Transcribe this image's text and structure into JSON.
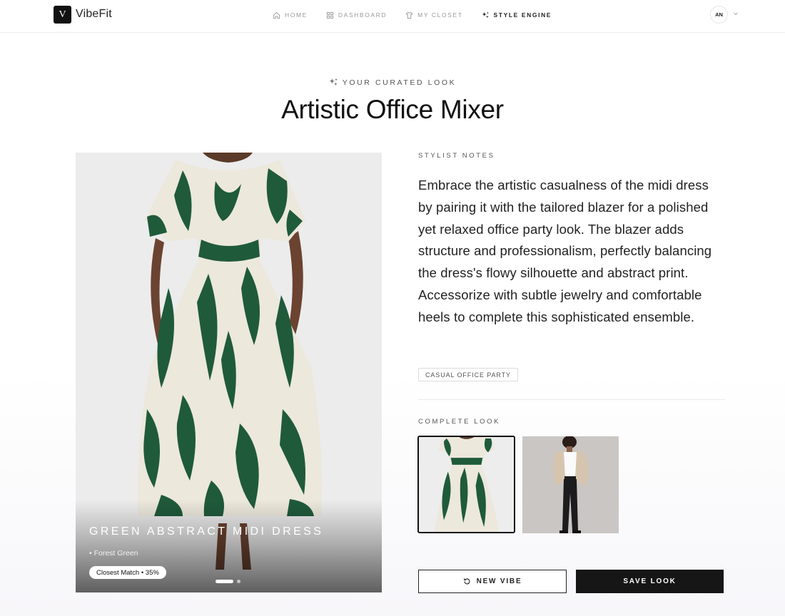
{
  "app": {
    "logo_letter": "V",
    "brand": "VibeFit"
  },
  "nav": {
    "items": [
      {
        "label": "HOME",
        "icon": "home-icon"
      },
      {
        "label": "DASHBOARD",
        "icon": "grid-icon"
      },
      {
        "label": "MY CLOSET",
        "icon": "shirt-icon"
      },
      {
        "label": "STYLE ENGINE",
        "icon": "sparkles-icon",
        "active": true
      }
    ]
  },
  "user": {
    "initials": "AN",
    "menu_icon": "chevron-down-icon"
  },
  "header": {
    "eyebrow": "YOUR CURATED LOOK",
    "eyebrow_icon": "sparkles-icon",
    "title": "Artistic Office Mixer"
  },
  "hero": {
    "item_name": "GREEN ABSTRACT MIDI DRESS",
    "color": "• Forest Green",
    "match_badge": "Closest Match • 35%",
    "carousel": {
      "count": 2,
      "active": 1
    }
  },
  "stylist": {
    "label": "STYLIST NOTES",
    "notes": "Embrace the artistic casualness of the midi dress by pairing it with the tailored blazer for a polished yet relaxed office party look. The blazer adds structure and professionalism, perfectly balancing the dress's flowy silhouette and abstract print. Accessorize with subtle jewelry and comfortable heels to complete this sophisticated ensemble.",
    "tag": "CASUAL OFFICE PARTY"
  },
  "complete_look": {
    "label": "COMPLETE LOOK",
    "items": [
      {
        "name": "green-abstract-midi-dress-thumbnail",
        "selected": true
      },
      {
        "name": "beige-blazer-outfit-thumbnail",
        "selected": false
      }
    ]
  },
  "actions": {
    "new_vibe": "NEW VIBE",
    "new_vibe_icon": "refresh-icon",
    "save_look": "SAVE LOOK"
  },
  "colors": {
    "dress_green": "#1f5a3b",
    "dress_cream": "#ece8dc",
    "primary_dark": "#161616"
  }
}
